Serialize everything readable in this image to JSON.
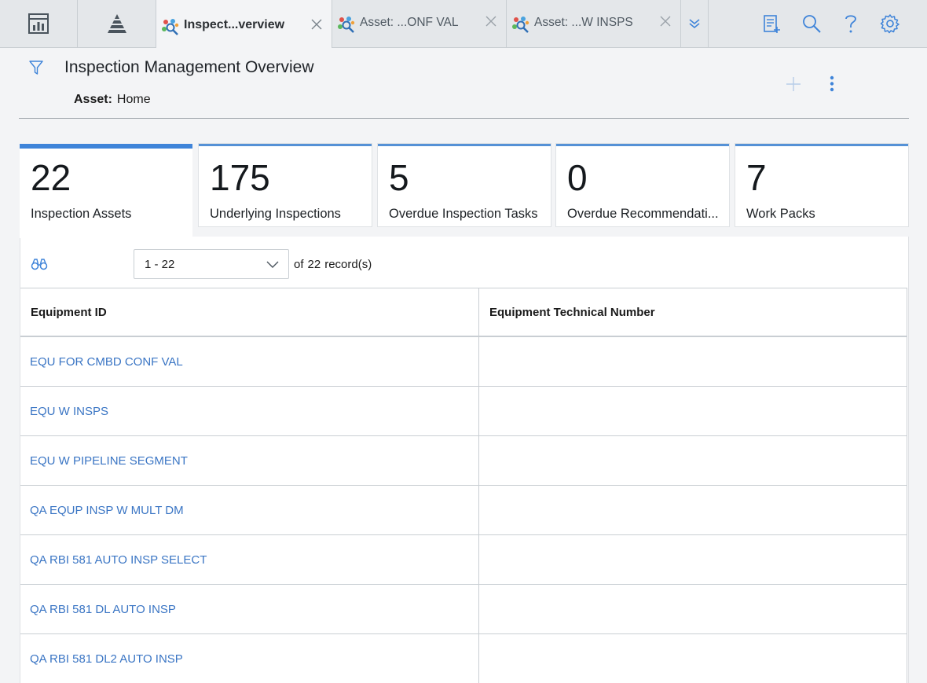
{
  "tabs": {
    "active": {
      "label": "Inspect...verview"
    },
    "second": {
      "label": "Asset: ...ONF VAL"
    },
    "third": {
      "label": "Asset: ...W INSPS"
    }
  },
  "header": {
    "title": "Inspection Management Overview",
    "asset_label": "Asset:",
    "asset_value": "Home"
  },
  "kpis": [
    {
      "value": "22",
      "label": "Inspection Assets"
    },
    {
      "value": "175",
      "label": "Underlying Inspections"
    },
    {
      "value": "5",
      "label": "Overdue Inspection Tasks"
    },
    {
      "value": "0",
      "label": "Overdue Recommendati..."
    },
    {
      "value": "7",
      "label": "Work Packs"
    }
  ],
  "pager": {
    "range": "1 - 22",
    "of": "of",
    "total": "22",
    "suffix": "record(s)"
  },
  "table": {
    "columns": [
      "Equipment ID",
      "Equipment Technical Number"
    ],
    "rows": [
      {
        "id": "EQU FOR CMBD CONF VAL",
        "tech": ""
      },
      {
        "id": "EQU W INSPS",
        "tech": ""
      },
      {
        "id": "EQU W PIPELINE SEGMENT",
        "tech": ""
      },
      {
        "id": "QA EQUP INSP W MULT DM",
        "tech": ""
      },
      {
        "id": "QA RBI 581 AUTO INSP SELECT",
        "tech": ""
      },
      {
        "id": "QA RBI 581 DL AUTO INSP",
        "tech": ""
      },
      {
        "id": "QA RBI 581 DL2 AUTO INSP",
        "tech": ""
      }
    ]
  },
  "icons": {
    "nav_dashboard": "dashboard-icon",
    "nav_pyramid": "pyramid-icon",
    "tab_icon": "inspection-network-icon",
    "close": "close-icon",
    "overflow": "double-chevron-down-icon",
    "notes": "clipboard-add-icon",
    "search": "search-icon",
    "help": "help-icon",
    "settings": "gear-icon",
    "filter": "filter-icon",
    "add": "plus-icon",
    "more": "kebab-icon",
    "find": "binoculars-icon"
  },
  "colors": {
    "accent": "#3f84d9",
    "link": "#3a75c4"
  }
}
